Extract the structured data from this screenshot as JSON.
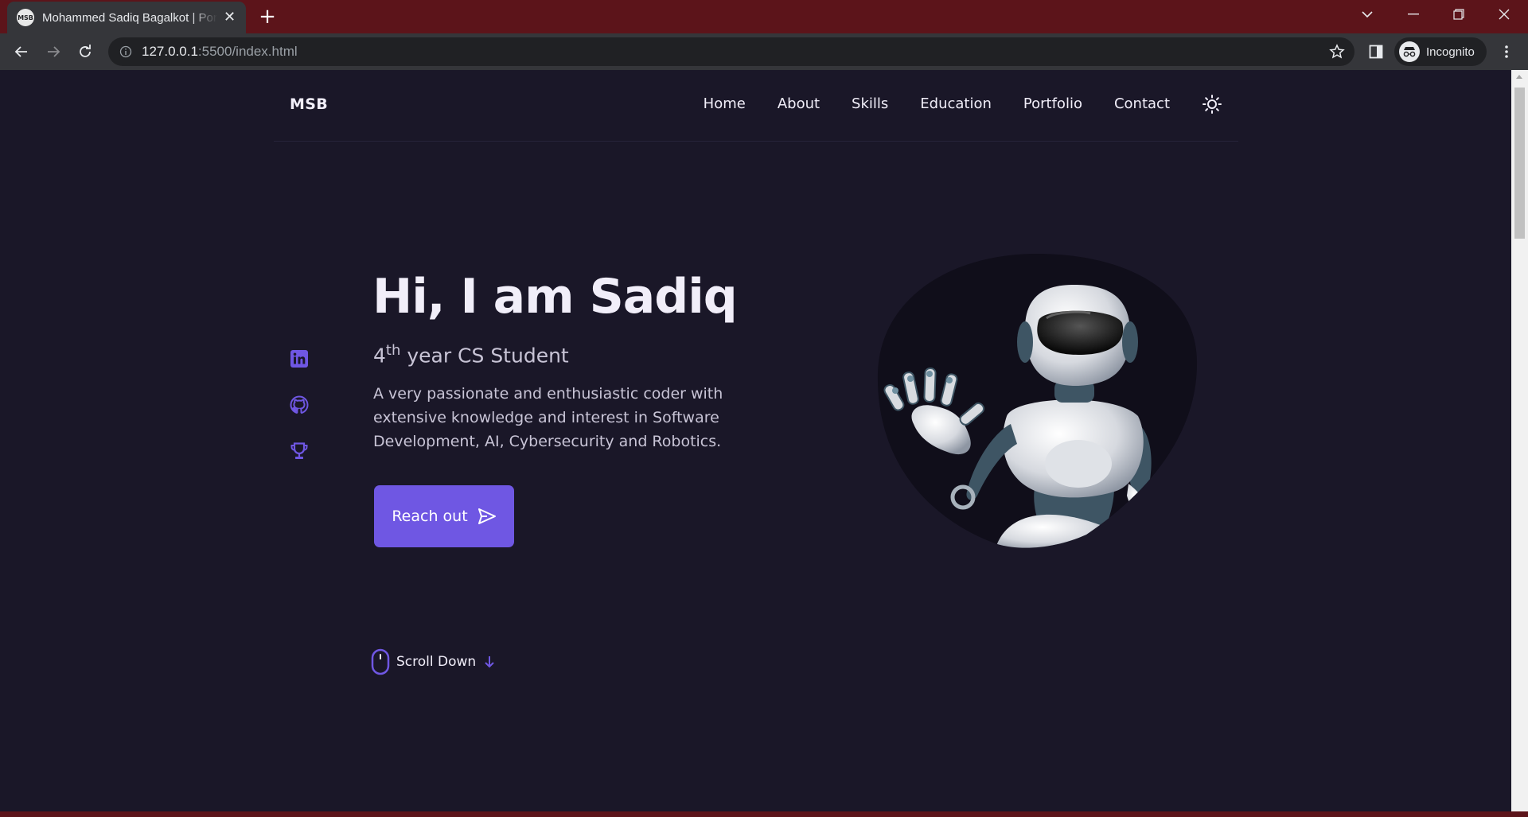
{
  "browser": {
    "tab_title": "Mohammed Sadiq Bagalkot | Portfolio",
    "favicon_text": "MSB",
    "url_host": "127.0.0.1",
    "url_rest": ":5500/index.html",
    "profile_label": "Incognito"
  },
  "nav": {
    "logo": "MSB",
    "links": [
      "Home",
      "About",
      "Skills",
      "Education",
      "Portfolio",
      "Contact"
    ],
    "theme_icon": "sun-icon"
  },
  "hero": {
    "title": "Hi, I am Sadiq",
    "subtitle_num": "4",
    "subtitle_sup": "th",
    "subtitle_rest": " year CS Student",
    "description": "A very passionate and enthusiastic coder with extensive knowledge and interest in Software Development, AI, Cybersecurity and Robotics.",
    "button_label": "Reach out",
    "scroll_label": "Scroll Down"
  },
  "socials": [
    "linkedin-icon",
    "github-icon",
    "trophy-icon"
  ],
  "colors": {
    "accent": "#6f57e3",
    "page_bg": "#1a1728",
    "text": "#f1eef9",
    "frame": "#5c141a"
  }
}
